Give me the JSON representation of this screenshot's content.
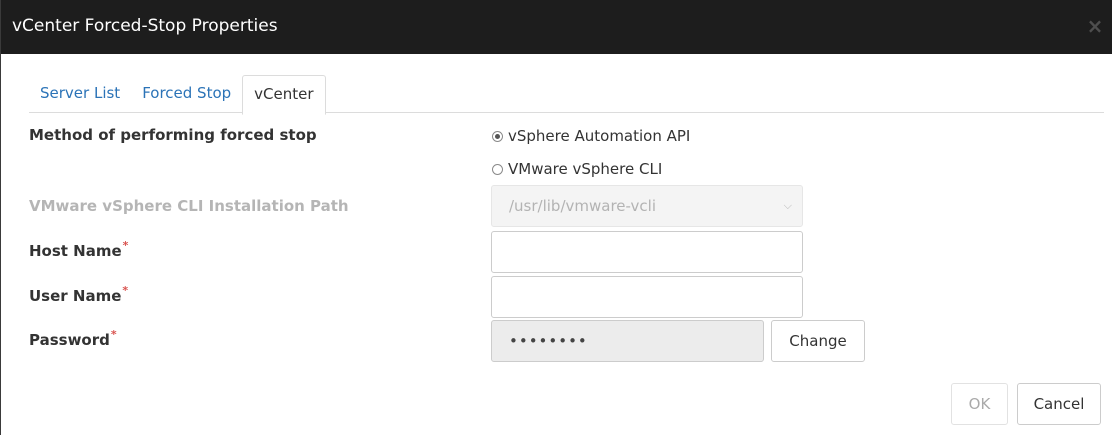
{
  "window": {
    "title": "vCenter Forced-Stop Properties",
    "close_glyph": "×"
  },
  "tabs": [
    {
      "label": "Server List",
      "active": false
    },
    {
      "label": "Forced Stop",
      "active": false
    },
    {
      "label": "vCenter",
      "active": true
    }
  ],
  "form": {
    "method_label": "Method of performing forced stop",
    "method_options": [
      {
        "label": "vSphere Automation API",
        "selected": true
      },
      {
        "label": "VMware vSphere CLI",
        "selected": false
      }
    ],
    "cli_path_label": "VMware vSphere CLI Installation Path",
    "cli_path_value": "/usr/lib/vmware-vcli",
    "host_name_label": "Host Name",
    "host_name_value": "",
    "user_name_label": "User Name",
    "user_name_value": "",
    "password_label": "Password",
    "password_mask": "••••••••",
    "required_mark": "*",
    "change_button": "Change"
  },
  "footer": {
    "ok_label": "OK",
    "cancel_label": "Cancel"
  },
  "colors": {
    "titlebar": "#1d1d1d",
    "tab_link": "#2b73b7",
    "required": "#d9534f"
  },
  "icons": {
    "close": "close-icon",
    "dropdown": "chevron-down-icon"
  }
}
